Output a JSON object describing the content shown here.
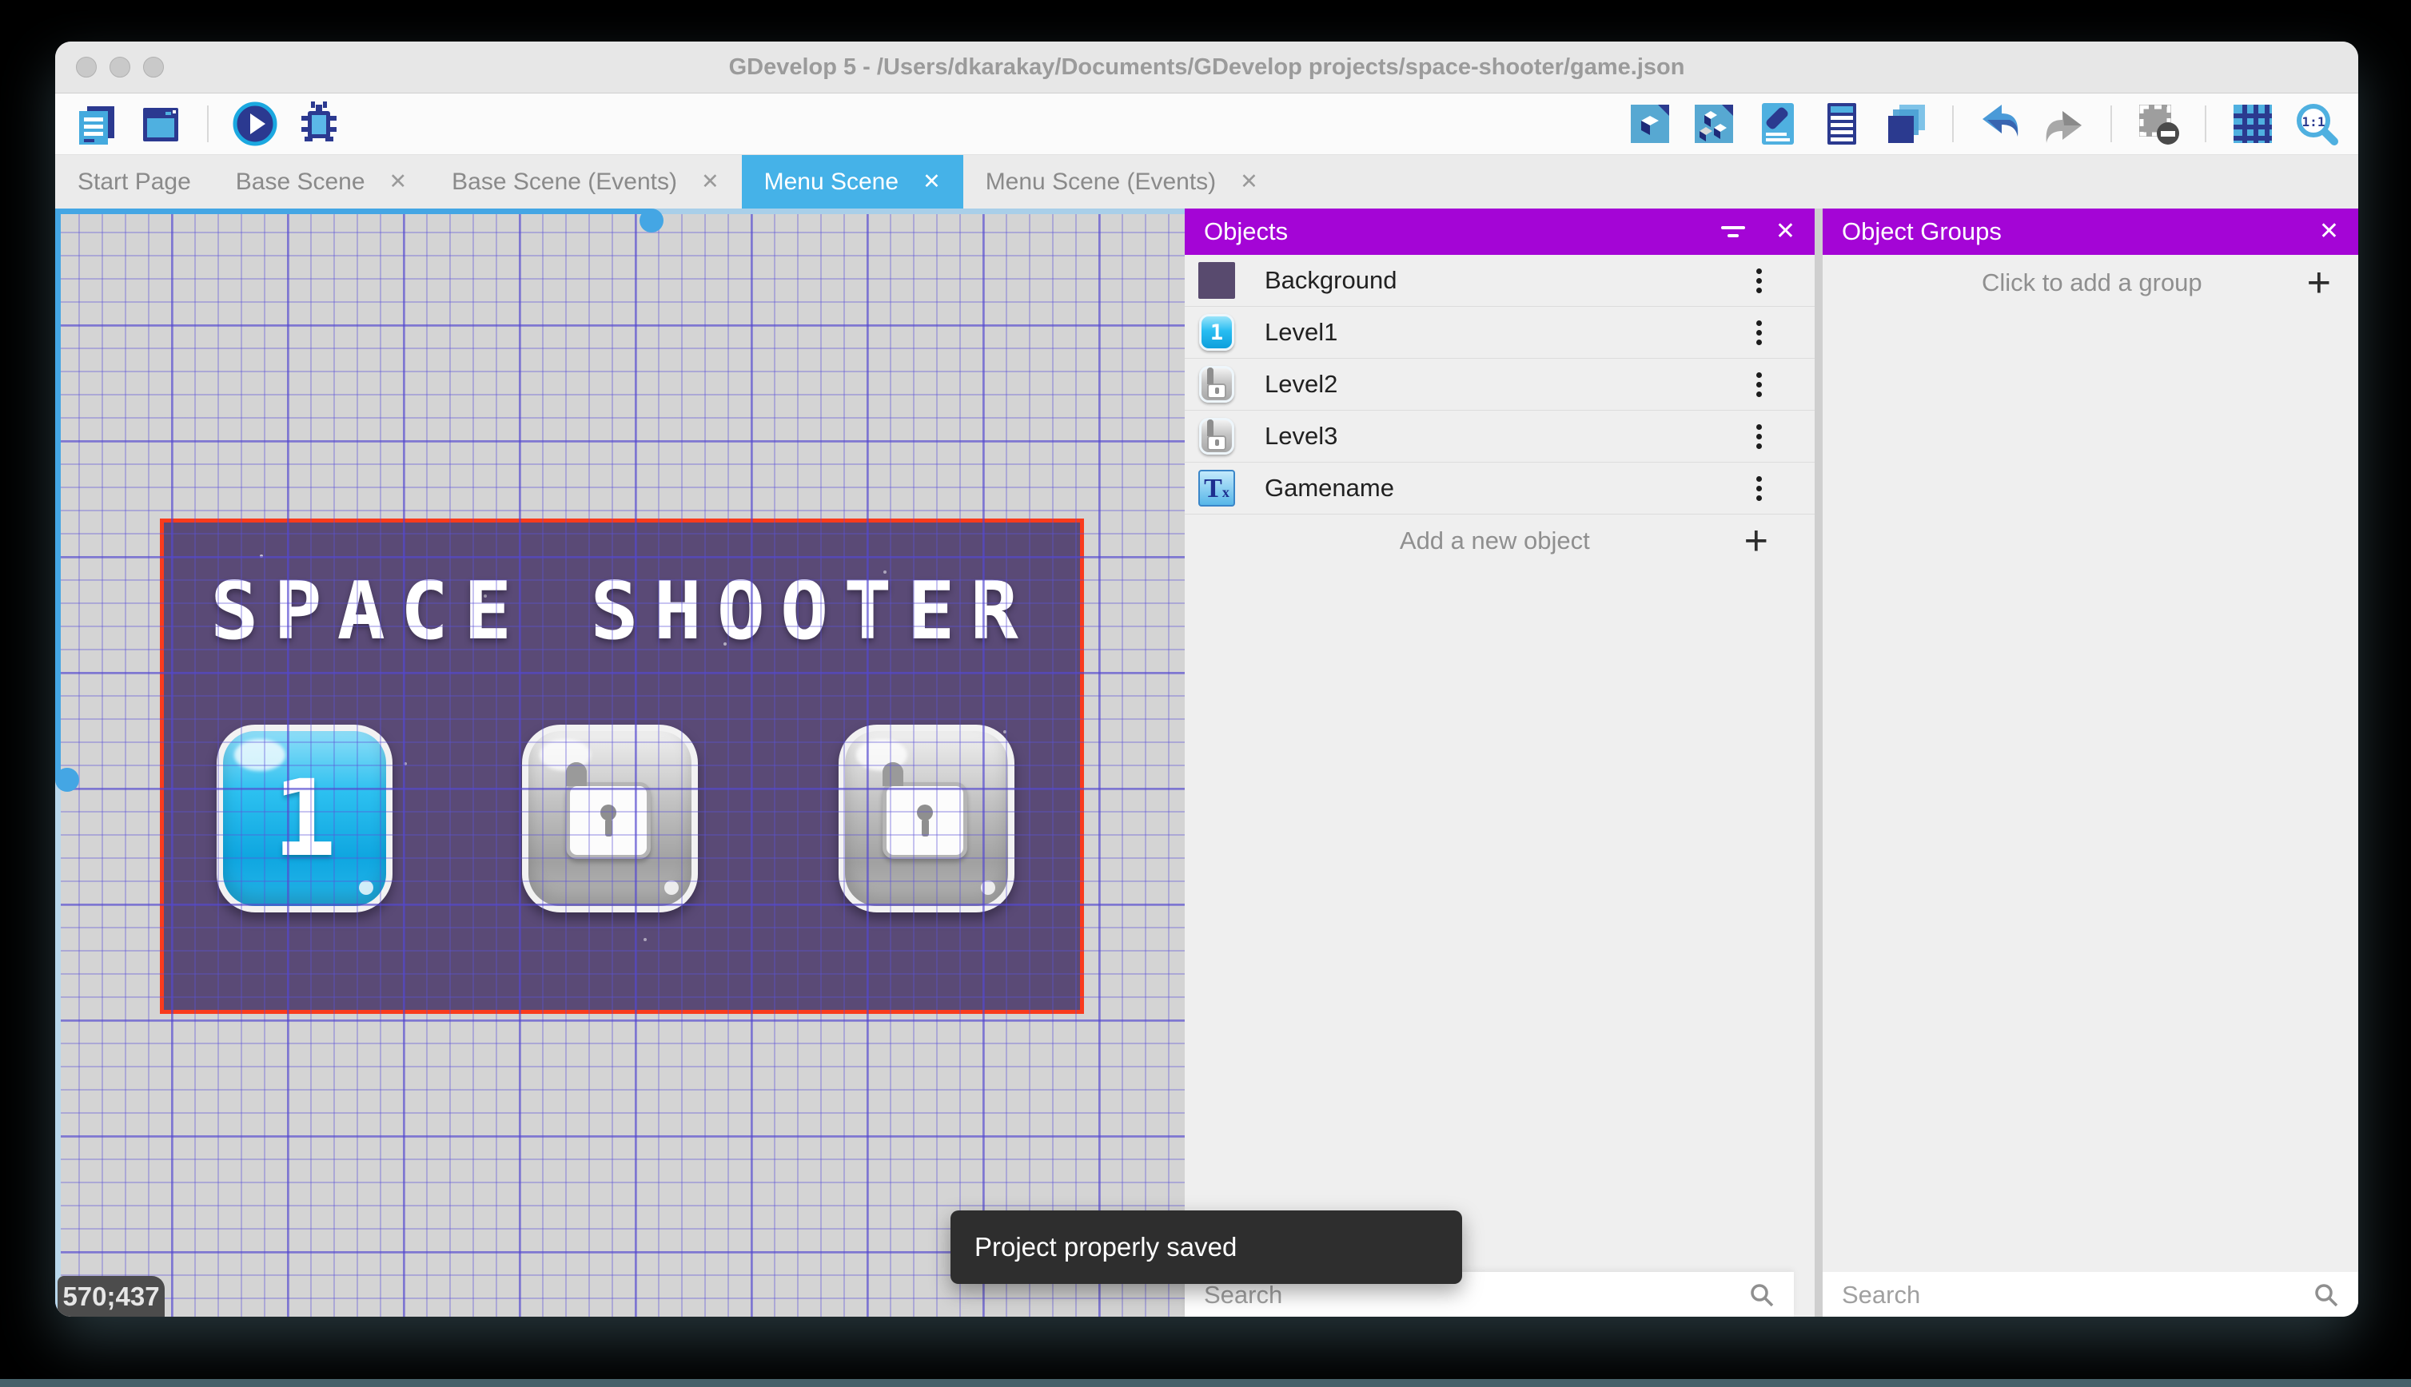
{
  "window": {
    "title": "GDevelop 5 - /Users/dkarakay/Documents/GDevelop projects/space-shooter/game.json"
  },
  "ui": {
    "close_glyph": "✕",
    "plus_glyph": "+"
  },
  "toolbar": {
    "left_icons": [
      "project-manager-icon",
      "scene-window-icon",
      "play-icon",
      "debug-icon"
    ],
    "right_icons": [
      "objects-editor-icon",
      "object-groups-icon",
      "properties-icon",
      "instances-list-icon",
      "layers-icon",
      "undo-icon",
      "redo-icon",
      "mask-icon",
      "grid-icon",
      "zoom-one-to-one-icon"
    ],
    "zoom_ratio": "1:1"
  },
  "tabs": [
    {
      "label": "Start Page",
      "closable": false,
      "active": false
    },
    {
      "label": "Base Scene",
      "closable": true,
      "active": false
    },
    {
      "label": "Base Scene (Events)",
      "closable": true,
      "active": false
    },
    {
      "label": "Menu Scene",
      "closable": true,
      "active": true
    },
    {
      "label": "Menu Scene (Events)",
      "closable": true,
      "active": false
    }
  ],
  "scene": {
    "title_text": "SPACE SHOOTER",
    "level1_label": "1",
    "background_color": "#5a4a76",
    "selection_border_color": "#f93b1d"
  },
  "statusbar": {
    "coordinates": "570;437"
  },
  "toast": {
    "message": "Project properly saved"
  },
  "objects_panel": {
    "title": "Objects",
    "items": [
      {
        "name": "Background",
        "icon": "background-thumbnail"
      },
      {
        "name": "Level1",
        "icon": "level1-button-thumbnail",
        "glyph": "1"
      },
      {
        "name": "Level2",
        "icon": "locked-button-thumbnail"
      },
      {
        "name": "Level3",
        "icon": "locked-button-thumbnail"
      },
      {
        "name": "Gamename",
        "icon": "text-object-thumbnail",
        "glyph": "T",
        "glyph_sub": "x"
      }
    ],
    "add_label": "Add a new object",
    "search_placeholder": "Search"
  },
  "groups_panel": {
    "title": "Object Groups",
    "empty_label": "Click to add a group",
    "search_placeholder": "Search"
  },
  "colors": {
    "panel_header": "#a405d6",
    "active_tab": "#45b2e8",
    "accent_blue": "#44a6e4",
    "toolbar_navy": "#2b3990",
    "toolbar_blue": "#4aa6d8"
  }
}
